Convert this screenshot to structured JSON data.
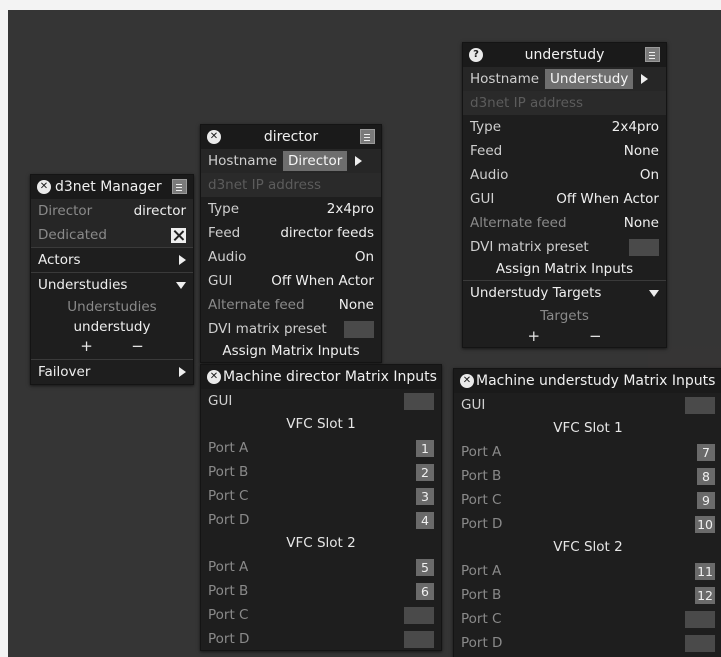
{
  "d3net_manager": {
    "title": "d3net Manager",
    "director_label": "Director",
    "director_value": "director",
    "dedicated_label": "Dedicated",
    "actors_label": "Actors",
    "understudies_label": "Understudies",
    "understudies_list_label": "Understudies",
    "understudies_list_item": "understudy",
    "plus": "+",
    "minus": "−",
    "failover_label": "Failover"
  },
  "director": {
    "title": "director",
    "hostname_label": "Hostname",
    "hostname_value": "Director",
    "ip_placeholder": "d3net IP address",
    "type_label": "Type",
    "type_value": "2x4pro",
    "feed_label": "Feed",
    "feed_value": "director feeds",
    "audio_label": "Audio",
    "audio_value": "On",
    "gui_label": "GUI",
    "gui_value": "Off When Actor",
    "altfeed_label": "Alternate feed",
    "altfeed_value": "None",
    "dvi_label": "DVI matrix preset",
    "assign_label": "Assign Matrix Inputs"
  },
  "understudy": {
    "title": "understudy",
    "hostname_label": "Hostname",
    "hostname_value": "Understudy",
    "ip_placeholder": "d3net IP address",
    "type_label": "Type",
    "type_value": "2x4pro",
    "feed_label": "Feed",
    "feed_value": "None",
    "audio_label": "Audio",
    "audio_value": "On",
    "gui_label": "GUI",
    "gui_value": "Off When Actor",
    "altfeed_label": "Alternate feed",
    "altfeed_value": "None",
    "dvi_label": "DVI matrix preset",
    "assign_label": "Assign Matrix Inputs",
    "targets_header": "Understudy Targets",
    "targets_label": "Targets",
    "plus": "+",
    "minus": "−"
  },
  "director_matrix": {
    "title": "Machine director Matrix Inputs",
    "gui_label": "GUI",
    "slot1_label": "VFC Slot 1",
    "slot2_label": "VFC Slot 2",
    "slot1_ports": [
      {
        "label": "Port A",
        "value": "1"
      },
      {
        "label": "Port B",
        "value": "2"
      },
      {
        "label": "Port C",
        "value": "3"
      },
      {
        "label": "Port D",
        "value": "4"
      }
    ],
    "slot2_ports": [
      {
        "label": "Port A",
        "value": "5"
      },
      {
        "label": "Port B",
        "value": "6"
      },
      {
        "label": "Port C",
        "value": ""
      },
      {
        "label": "Port D",
        "value": ""
      }
    ]
  },
  "understudy_matrix": {
    "title": "Machine understudy Matrix Inputs",
    "gui_label": "GUI",
    "slot1_label": "VFC Slot 1",
    "slot2_label": "VFC Slot 2",
    "slot1_ports": [
      {
        "label": "Port A",
        "value": "7"
      },
      {
        "label": "Port B",
        "value": "8"
      },
      {
        "label": "Port C",
        "value": "9"
      },
      {
        "label": "Port D",
        "value": "10"
      }
    ],
    "slot2_ports": [
      {
        "label": "Port A",
        "value": "11"
      },
      {
        "label": "Port B",
        "value": "12"
      },
      {
        "label": "Port C",
        "value": ""
      },
      {
        "label": "Port D",
        "value": ""
      }
    ]
  },
  "icons": {
    "close": "close-icon",
    "edit": "edit-icon",
    "help": "help-icon"
  }
}
